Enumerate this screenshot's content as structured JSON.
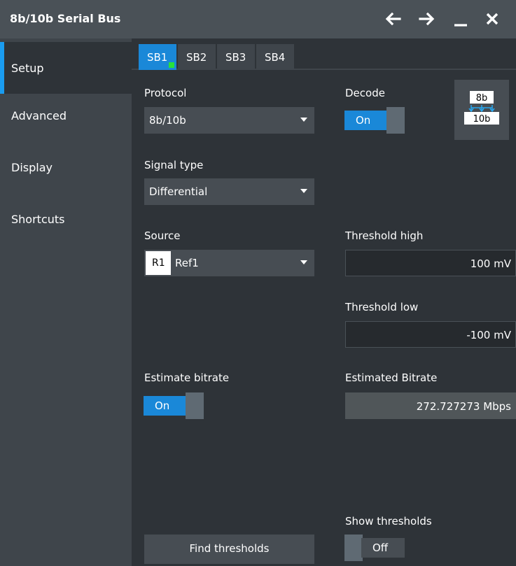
{
  "window": {
    "title": "8b/10b Serial Bus",
    "controls": [
      "back-arrow-icon",
      "forward-arrow-icon",
      "minimize-icon",
      "close-icon"
    ]
  },
  "sidebar": {
    "items": [
      {
        "label": "Setup",
        "active": true
      },
      {
        "label": "Advanced",
        "active": false
      },
      {
        "label": "Display",
        "active": false
      },
      {
        "label": "Shortcuts",
        "active": false
      }
    ]
  },
  "tabs": [
    {
      "label": "SB1",
      "active": true,
      "indicator": "green"
    },
    {
      "label": "SB2",
      "active": false
    },
    {
      "label": "SB3",
      "active": false
    },
    {
      "label": "SB4",
      "active": false
    }
  ],
  "setup": {
    "protocol": {
      "label": "Protocol",
      "value": "8b/10b"
    },
    "decode": {
      "label": "Decode",
      "state": "On"
    },
    "codec_icon": {
      "top": "8b",
      "bottom": "10b"
    },
    "signal_type": {
      "label": "Signal type",
      "value": "Differential"
    },
    "source": {
      "label": "Source",
      "badge": "R1",
      "value": "Ref1"
    },
    "threshold_high": {
      "label": "Threshold high",
      "value": "100 mV"
    },
    "threshold_low": {
      "label": "Threshold low",
      "value": "-100 mV"
    },
    "estimate_bitrate": {
      "label": "Estimate bitrate",
      "state": "On"
    },
    "estimated_bitrate": {
      "label": "Estimated Bitrate",
      "value": "272.727273 Mbps"
    },
    "show_thresholds": {
      "label": "Show thresholds",
      "state": "Off"
    },
    "find_thresholds": {
      "label": "Find thresholds"
    }
  },
  "colors": {
    "accent": "#1a88d8",
    "active_indicator": "#28e13a",
    "background": "#2e3338",
    "sidebar": "#3f454b",
    "titlebar": "#4a5157"
  }
}
